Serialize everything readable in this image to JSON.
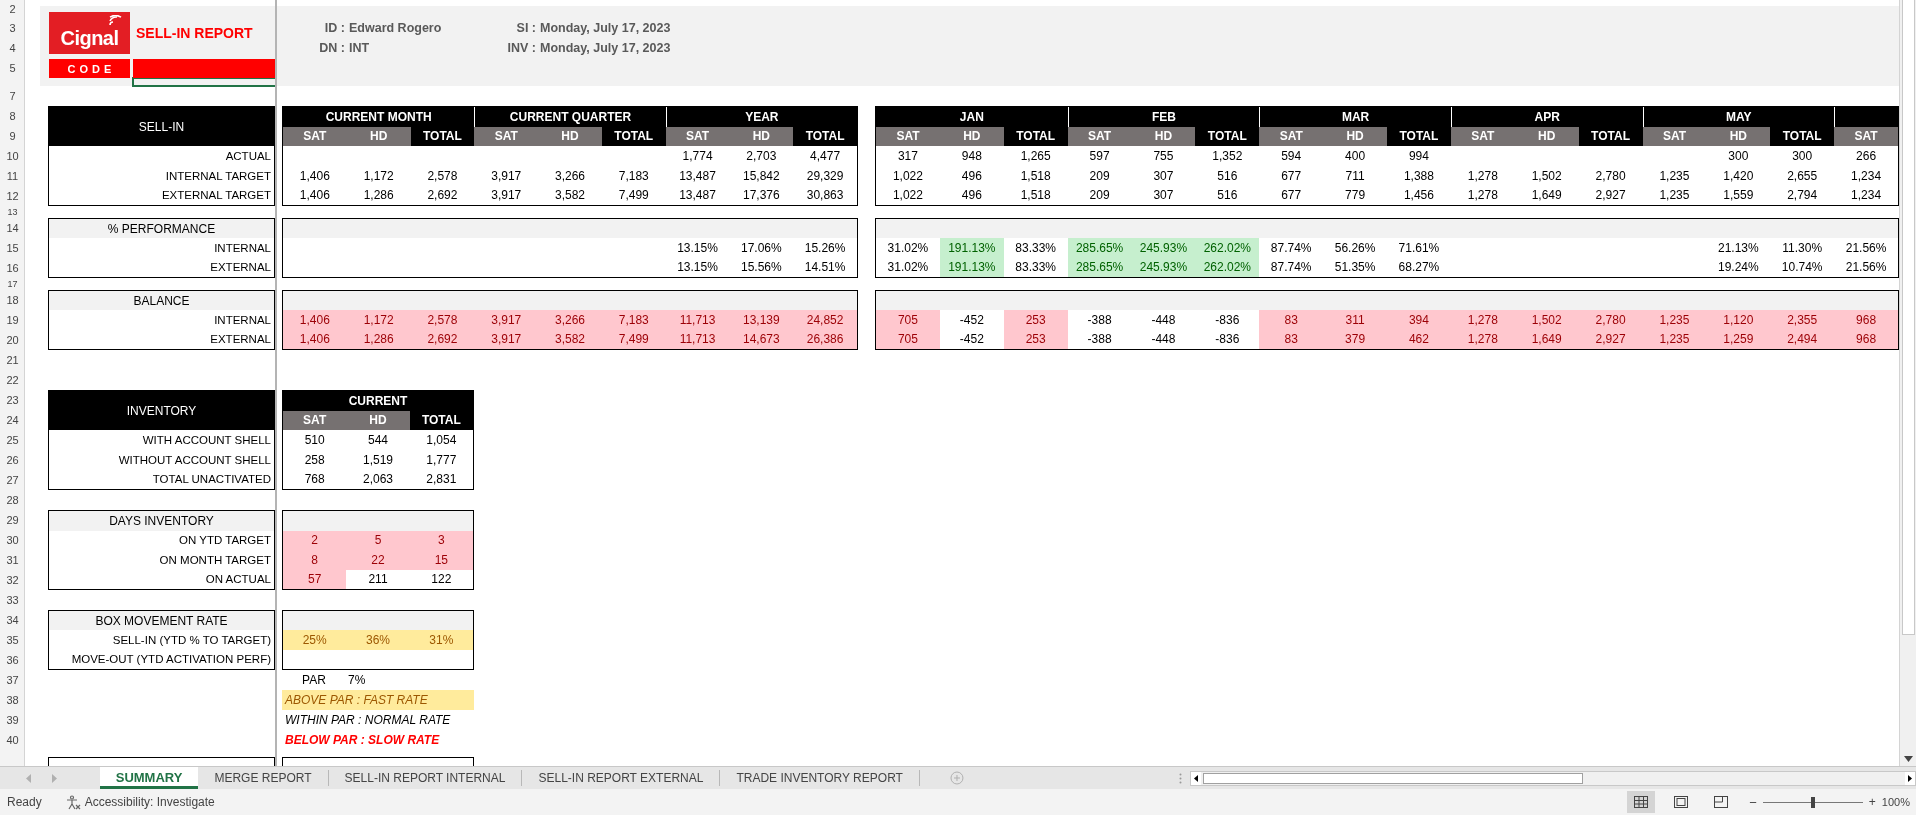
{
  "header": {
    "logo": "Cignal",
    "title": "SELL-IN REPORT",
    "code_label": "CODE",
    "fields": [
      {
        "label": "ID :",
        "value": "Edward Rogero"
      },
      {
        "label": "SI :",
        "value": "Monday, July 17, 2023"
      },
      {
        "label": "DN :",
        "value": "INT"
      },
      {
        "label": "INV :",
        "value": "Monday, July 17, 2023"
      }
    ]
  },
  "row_numbers": [
    "2",
    "3",
    "4",
    "5",
    "7",
    "8",
    "9",
    "10",
    "11",
    "12",
    "13",
    "14",
    "15",
    "16",
    "17",
    "18",
    "19",
    "20",
    "21",
    "22",
    "23",
    "24",
    "25",
    "26",
    "27",
    "28",
    "29",
    "30",
    "31",
    "32",
    "33",
    "34",
    "35",
    "36",
    "37",
    "38",
    "39",
    "40"
  ],
  "sections": [
    {
      "kind": "black",
      "title": "SELL-IN",
      "labels": [
        "ACTUAL",
        "INTERNAL TARGET",
        "EXTERNAL TARGET"
      ],
      "panels": [
        {
          "groups": [
            {
              "label": "CURRENT MONTH",
              "columns": [
                {
                  "label": "SAT",
                  "kind": "part"
                },
                {
                  "label": "HD",
                  "kind": "part"
                },
                {
                  "label": "TOTAL",
                  "kind": "total"
                }
              ]
            },
            {
              "label": "CURRENT QUARTER",
              "columns": [
                {
                  "label": "SAT",
                  "kind": "part"
                },
                {
                  "label": "HD",
                  "kind": "part"
                },
                {
                  "label": "TOTAL",
                  "kind": "total"
                }
              ]
            },
            {
              "label": "YEAR",
              "columns": [
                {
                  "label": "SAT",
                  "kind": "part"
                },
                {
                  "label": "HD",
                  "kind": "part"
                },
                {
                  "label": "TOTAL",
                  "kind": "total"
                }
              ]
            }
          ],
          "rows": [
            {
              "cells": [
                {
                  "kind": "empty"
                },
                {
                  "kind": "empty"
                },
                {
                  "kind": "empty"
                },
                {
                  "kind": "empty"
                },
                {
                  "kind": "empty"
                },
                {
                  "kind": "empty"
                },
                {
                  "kind": "value",
                  "text": "1,774"
                },
                {
                  "kind": "value",
                  "text": "2,703"
                },
                {
                  "kind": "value",
                  "text": "4,477"
                }
              ]
            },
            {
              "cells": [
                {
                  "kind": "value",
                  "text": "1,406"
                },
                {
                  "kind": "value",
                  "text": "1,172"
                },
                {
                  "kind": "value",
                  "text": "2,578"
                },
                {
                  "kind": "value",
                  "text": "3,917"
                },
                {
                  "kind": "value",
                  "text": "3,266"
                },
                {
                  "kind": "value",
                  "text": "7,183"
                },
                {
                  "kind": "value",
                  "text": "13,487"
                },
                {
                  "kind": "value",
                  "text": "15,842"
                },
                {
                  "kind": "value",
                  "text": "29,329"
                }
              ]
            },
            {
              "cells": [
                {
                  "kind": "value",
                  "text": "1,406"
                },
                {
                  "kind": "value",
                  "text": "1,286"
                },
                {
                  "kind": "value",
                  "text": "2,692"
                },
                {
                  "kind": "value",
                  "text": "3,917"
                },
                {
                  "kind": "value",
                  "text": "3,582"
                },
                {
                  "kind": "value",
                  "text": "7,499"
                },
                {
                  "kind": "value",
                  "text": "13,487"
                },
                {
                  "kind": "value",
                  "text": "17,376"
                },
                {
                  "kind": "value",
                  "text": "30,863"
                }
              ]
            }
          ]
        },
        {
          "groups": [
            {
              "label": "JAN",
              "columns": [
                {
                  "label": "SAT",
                  "kind": "part"
                },
                {
                  "label": "HD",
                  "kind": "part"
                },
                {
                  "label": "TOTAL",
                  "kind": "total"
                }
              ]
            },
            {
              "label": "FEB",
              "columns": [
                {
                  "label": "SAT",
                  "kind": "part"
                },
                {
                  "label": "HD",
                  "kind": "part"
                },
                {
                  "label": "TOTAL",
                  "kind": "total"
                }
              ]
            },
            {
              "label": "MAR",
              "columns": [
                {
                  "label": "SAT",
                  "kind": "part"
                },
                {
                  "label": "HD",
                  "kind": "part"
                },
                {
                  "label": "TOTAL",
                  "kind": "total"
                }
              ]
            },
            {
              "label": "APR",
              "columns": [
                {
                  "label": "SAT",
                  "kind": "part"
                },
                {
                  "label": "HD",
                  "kind": "part"
                },
                {
                  "label": "TOTAL",
                  "kind": "total"
                }
              ]
            },
            {
              "label": "MAY",
              "columns": [
                {
                  "label": "SAT",
                  "kind": "part"
                },
                {
                  "label": "HD",
                  "kind": "part"
                },
                {
                  "label": "TOTAL",
                  "kind": "total"
                }
              ]
            },
            {
              "columns": [
                {
                  "label": "SAT",
                  "kind": "part"
                }
              ]
            }
          ],
          "rows": [
            {
              "cells": [
                {
                  "kind": "value",
                  "text": "317"
                },
                {
                  "kind": "value",
                  "text": "948"
                },
                {
                  "kind": "value",
                  "text": "1,265"
                },
                {
                  "kind": "value",
                  "text": "597"
                },
                {
                  "kind": "value",
                  "text": "755"
                },
                {
                  "kind": "value",
                  "text": "1,352"
                },
                {
                  "kind": "value",
                  "text": "594"
                },
                {
                  "kind": "value",
                  "text": "400"
                },
                {
                  "kind": "value",
                  "text": "994"
                },
                {
                  "kind": "empty"
                },
                {
                  "kind": "empty"
                },
                {
                  "kind": "empty"
                },
                {
                  "kind": "empty"
                },
                {
                  "kind": "value",
                  "text": "300"
                },
                {
                  "kind": "value",
                  "text": "300"
                },
                {
                  "kind": "value",
                  "text": "266"
                }
              ]
            },
            {
              "cells": [
                {
                  "kind": "value",
                  "text": "1,022"
                },
                {
                  "kind": "value",
                  "text": "496"
                },
                {
                  "kind": "value",
                  "text": "1,518"
                },
                {
                  "kind": "value",
                  "text": "209"
                },
                {
                  "kind": "value",
                  "text": "307"
                },
                {
                  "kind": "value",
                  "text": "516"
                },
                {
                  "kind": "value",
                  "text": "677"
                },
                {
                  "kind": "value",
                  "text": "711"
                },
                {
                  "kind": "value",
                  "text": "1,388"
                },
                {
                  "kind": "value",
                  "text": "1,278"
                },
                {
                  "kind": "value",
                  "text": "1,502"
                },
                {
                  "kind": "value",
                  "text": "2,780"
                },
                {
                  "kind": "value",
                  "text": "1,235"
                },
                {
                  "kind": "value",
                  "text": "1,420"
                },
                {
                  "kind": "value",
                  "text": "2,655"
                },
                {
                  "kind": "value",
                  "text": "1,234"
                }
              ]
            },
            {
              "cells": [
                {
                  "kind": "value",
                  "text": "1,022"
                },
                {
                  "kind": "value",
                  "text": "496"
                },
                {
                  "kind": "value",
                  "text": "1,518"
                },
                {
                  "kind": "value",
                  "text": "209"
                },
                {
                  "kind": "value",
                  "text": "307"
                },
                {
                  "kind": "value",
                  "text": "516"
                },
                {
                  "kind": "value",
                  "text": "677"
                },
                {
                  "kind": "value",
                  "text": "779"
                },
                {
                  "kind": "value",
                  "text": "1,456"
                },
                {
                  "kind": "value",
                  "text": "1,278"
                },
                {
                  "kind": "value",
                  "text": "1,649"
                },
                {
                  "kind": "value",
                  "text": "2,927"
                },
                {
                  "kind": "value",
                  "text": "1,235"
                },
                {
                  "kind": "value",
                  "text": "1,559"
                },
                {
                  "kind": "value",
                  "text": "2,794"
                },
                {
                  "kind": "value",
                  "text": "1,234"
                }
              ]
            }
          ]
        }
      ]
    },
    {
      "kind": "grey",
      "title": "% PERFORMANCE",
      "labels": [
        "INTERNAL",
        "EXTERNAL"
      ],
      "panels": [
        {
          "rows": [
            {
              "cells": [
                {
                  "kind": "empty"
                },
                {
                  "kind": "empty"
                },
                {
                  "kind": "empty"
                },
                {
                  "kind": "empty"
                },
                {
                  "kind": "empty"
                },
                {
                  "kind": "empty"
                },
                {
                  "kind": "value",
                  "text": "13.15%"
                },
                {
                  "kind": "value",
                  "text": "17.06%"
                },
                {
                  "kind": "value",
                  "text": "15.26%"
                }
              ]
            },
            {
              "cells": [
                {
                  "kind": "empty"
                },
                {
                  "kind": "empty"
                },
                {
                  "kind": "empty"
                },
                {
                  "kind": "empty"
                },
                {
                  "kind": "empty"
                },
                {
                  "kind": "empty"
                },
                {
                  "kind": "value",
                  "text": "13.15%"
                },
                {
                  "kind": "value",
                  "text": "15.56%"
                },
                {
                  "kind": "value",
                  "text": "14.51%"
                }
              ]
            }
          ]
        },
        {
          "rows": [
            {
              "cells": [
                {
                  "kind": "value",
                  "text": "31.02%"
                },
                {
                  "kind": "value",
                  "text": "191.13%",
                  "color": "#c6efce"
                },
                {
                  "kind": "value",
                  "text": "83.33%"
                },
                {
                  "kind": "value",
                  "text": "285.65%",
                  "color": "#c6efce"
                },
                {
                  "kind": "value",
                  "text": "245.93%",
                  "color": "#c6efce"
                },
                {
                  "kind": "value",
                  "text": "262.02%",
                  "color": "#c6efce"
                },
                {
                  "kind": "value",
                  "text": "87.74%"
                },
                {
                  "kind": "value",
                  "text": "56.26%"
                },
                {
                  "kind": "value",
                  "text": "71.61%"
                },
                {
                  "kind": "empty"
                },
                {
                  "kind": "empty"
                },
                {
                  "kind": "empty"
                },
                {
                  "kind": "empty"
                },
                {
                  "kind": "value",
                  "text": "21.13%"
                },
                {
                  "kind": "value",
                  "text": "11.30%"
                },
                {
                  "kind": "value",
                  "text": "21.56%"
                }
              ]
            },
            {
              "cells": [
                {
                  "kind": "value",
                  "text": "31.02%"
                },
                {
                  "kind": "value",
                  "text": "191.13%",
                  "color": "#c6efce"
                },
                {
                  "kind": "value",
                  "text": "83.33%"
                },
                {
                  "kind": "value",
                  "text": "285.65%",
                  "color": "#c6efce"
                },
                {
                  "kind": "value",
                  "text": "245.93%",
                  "color": "#c6efce"
                },
                {
                  "kind": "value",
                  "text": "262.02%",
                  "color": "#c6efce"
                },
                {
                  "kind": "value",
                  "text": "87.74%"
                },
                {
                  "kind": "value",
                  "text": "51.35%"
                },
                {
                  "kind": "value",
                  "text": "68.27%"
                },
                {
                  "kind": "empty"
                },
                {
                  "kind": "empty"
                },
                {
                  "kind": "empty"
                },
                {
                  "kind": "empty"
                },
                {
                  "kind": "value",
                  "text": "19.24%"
                },
                {
                  "kind": "value",
                  "text": "10.74%"
                },
                {
                  "kind": "value",
                  "text": "21.56%"
                }
              ]
            }
          ]
        }
      ]
    },
    {
      "kind": "grey",
      "title": "BALANCE",
      "labels": [
        "INTERNAL",
        "EXTERNAL"
      ],
      "panels": [
        {
          "rows": [
            {
              "cells": [
                {
                  "kind": "value",
                  "text": "1,406",
                  "color": "#ffc7ce"
                },
                {
                  "kind": "value",
                  "text": "1,172",
                  "color": "#ffc7ce"
                },
                {
                  "kind": "value",
                  "text": "2,578",
                  "color": "#ffc7ce"
                },
                {
                  "kind": "value",
                  "text": "3,917",
                  "color": "#ffc7ce"
                },
                {
                  "kind": "value",
                  "text": "3,266",
                  "color": "#ffc7ce"
                },
                {
                  "kind": "value",
                  "text": "7,183",
                  "color": "#ffc7ce"
                },
                {
                  "kind": "value",
                  "text": "11,713",
                  "color": "#ffc7ce"
                },
                {
                  "kind": "value",
                  "text": "13,139",
                  "color": "#ffc7ce"
                },
                {
                  "kind": "value",
                  "text": "24,852",
                  "color": "#ffc7ce"
                }
              ]
            },
            {
              "cells": [
                {
                  "kind": "value",
                  "text": "1,406",
                  "color": "#ffc7ce"
                },
                {
                  "kind": "value",
                  "text": "1,286",
                  "color": "#ffc7ce"
                },
                {
                  "kind": "value",
                  "text": "2,692",
                  "color": "#ffc7ce"
                },
                {
                  "kind": "value",
                  "text": "3,917",
                  "color": "#ffc7ce"
                },
                {
                  "kind": "value",
                  "text": "3,582",
                  "color": "#ffc7ce"
                },
                {
                  "kind": "value",
                  "text": "7,499",
                  "color": "#ffc7ce"
                },
                {
                  "kind": "value",
                  "text": "11,713",
                  "color": "#ffc7ce"
                },
                {
                  "kind": "value",
                  "text": "14,673",
                  "color": "#ffc7ce"
                },
                {
                  "kind": "value",
                  "text": "26,386",
                  "color": "#ffc7ce"
                }
              ]
            }
          ]
        },
        {
          "rows": [
            {
              "cells": [
                {
                  "kind": "value",
                  "text": "705",
                  "color": "#ffc7ce"
                },
                {
                  "kind": "value",
                  "text": "-452"
                },
                {
                  "kind": "value",
                  "text": "253",
                  "color": "#ffc7ce"
                },
                {
                  "kind": "value",
                  "text": "-388"
                },
                {
                  "kind": "value",
                  "text": "-448"
                },
                {
                  "kind": "value",
                  "text": "-836"
                },
                {
                  "kind": "value",
                  "text": "83",
                  "color": "#ffc7ce"
                },
                {
                  "kind": "value",
                  "text": "311",
                  "color": "#ffc7ce"
                },
                {
                  "kind": "value",
                  "text": "394",
                  "color": "#ffc7ce"
                },
                {
                  "kind": "value",
                  "text": "1,278",
                  "color": "#ffc7ce"
                },
                {
                  "kind": "value",
                  "text": "1,502",
                  "color": "#ffc7ce"
                },
                {
                  "kind": "value",
                  "text": "2,780",
                  "color": "#ffc7ce"
                },
                {
                  "kind": "value",
                  "text": "1,235",
                  "color": "#ffc7ce"
                },
                {
                  "kind": "value",
                  "text": "1,120",
                  "color": "#ffc7ce"
                },
                {
                  "kind": "value",
                  "text": "2,355",
                  "color": "#ffc7ce"
                },
                {
                  "kind": "value",
                  "text": "968",
                  "color": "#ffc7ce"
                }
              ]
            },
            {
              "cells": [
                {
                  "kind": "value",
                  "text": "705",
                  "color": "#ffc7ce"
                },
                {
                  "kind": "value",
                  "text": "-452"
                },
                {
                  "kind": "value",
                  "text": "253",
                  "color": "#ffc7ce"
                },
                {
                  "kind": "value",
                  "text": "-388"
                },
                {
                  "kind": "value",
                  "text": "-448"
                },
                {
                  "kind": "value",
                  "text": "-836"
                },
                {
                  "kind": "value",
                  "text": "83",
                  "color": "#ffc7ce"
                },
                {
                  "kind": "value",
                  "text": "379",
                  "color": "#ffc7ce"
                },
                {
                  "kind": "value",
                  "text": "462",
                  "color": "#ffc7ce"
                },
                {
                  "kind": "value",
                  "text": "1,278",
                  "color": "#ffc7ce"
                },
                {
                  "kind": "value",
                  "text": "1,649",
                  "color": "#ffc7ce"
                },
                {
                  "kind": "value",
                  "text": "2,927",
                  "color": "#ffc7ce"
                },
                {
                  "kind": "value",
                  "text": "1,235",
                  "color": "#ffc7ce"
                },
                {
                  "kind": "value",
                  "text": "1,259",
                  "color": "#ffc7ce"
                },
                {
                  "kind": "value",
                  "text": "2,494",
                  "color": "#ffc7ce"
                },
                {
                  "kind": "value",
                  "text": "968",
                  "color": "#ffc7ce"
                }
              ]
            }
          ]
        }
      ]
    },
    {
      "kind": "black",
      "title": "INVENTORY",
      "labels": [
        "WITH ACCOUNT SHELL",
        "WITHOUT ACCOUNT SHELL",
        "TOTAL UNACTIVATED"
      ],
      "panels": [
        {
          "groups": [
            {
              "label": "CURRENT",
              "columns": [
                {
                  "label": "SAT",
                  "kind": "part"
                },
                {
                  "label": "HD",
                  "kind": "part"
                },
                {
                  "label": "TOTAL",
                  "kind": "total"
                }
              ]
            }
          ],
          "rows": [
            {
              "cells": [
                {
                  "kind": "value",
                  "text": "510"
                },
                {
                  "kind": "value",
                  "text": "544"
                },
                {
                  "kind": "value",
                  "text": "1,054"
                }
              ]
            },
            {
              "cells": [
                {
                  "kind": "value",
                  "text": "258"
                },
                {
                  "kind": "value",
                  "text": "1,519"
                },
                {
                  "kind": "value",
                  "text": "1,777"
                }
              ]
            },
            {
              "cells": [
                {
                  "kind": "value",
                  "text": "768"
                },
                {
                  "kind": "value",
                  "text": "2,063"
                },
                {
                  "kind": "value",
                  "text": "2,831"
                }
              ]
            }
          ]
        }
      ]
    },
    {
      "kind": "grey",
      "title": "DAYS INVENTORY",
      "labels": [
        "ON YTD TARGET",
        "ON MONTH TARGET",
        "ON ACTUAL"
      ],
      "panels": [
        {
          "rows": [
            {
              "cells": [
                {
                  "kind": "value",
                  "text": "2",
                  "color": "#ffc7ce"
                },
                {
                  "kind": "value",
                  "text": "5",
                  "color": "#ffc7ce"
                },
                {
                  "kind": "value",
                  "text": "3",
                  "color": "#ffc7ce"
                }
              ]
            },
            {
              "cells": [
                {
                  "kind": "value",
                  "text": "8",
                  "color": "#ffc7ce"
                },
                {
                  "kind": "value",
                  "text": "22",
                  "color": "#ffc7ce"
                },
                {
                  "kind": "value",
                  "text": "15",
                  "color": "#ffc7ce"
                }
              ]
            },
            {
              "cells": [
                {
                  "kind": "value",
                  "text": "57",
                  "color": "#ffc7ce"
                },
                {
                  "kind": "value",
                  "text": "211"
                },
                {
                  "kind": "value",
                  "text": "122"
                }
              ]
            }
          ]
        }
      ]
    },
    {
      "kind": "grey",
      "title": "BOX MOVEMENT RATE",
      "labels": [
        "SELL-IN (YTD % TO TARGET)",
        "MOVE-OUT (YTD ACTIVATION PERF)"
      ],
      "panels": [
        {
          "rows": [
            {
              "cells": [
                {
                  "kind": "value",
                  "text": "25%",
                  "color": "#ffeb9c"
                },
                {
                  "kind": "value",
                  "text": "36%",
                  "color": "#ffeb9c"
                },
                {
                  "kind": "value",
                  "text": "31%",
                  "color": "#ffeb9c"
                }
              ]
            },
            {
              "cells": [
                {
                  "kind": "empty"
                },
                {
                  "kind": "empty"
                },
                {
                  "kind": "empty"
                }
              ]
            }
          ]
        }
      ]
    }
  ],
  "par": {
    "label": "PAR",
    "value": "7%"
  },
  "legend": [
    {
      "kind": "above",
      "text": "ABOVE PAR : FAST RATE"
    },
    {
      "kind": "within",
      "text": "WITHIN PAR : NORMAL RATE"
    },
    {
      "kind": "below",
      "text": "BELOW PAR : SLOW RATE"
    }
  ],
  "tabs": [
    {
      "label": "SUMMARY",
      "selected": true
    },
    {
      "label": "MERGE REPORT",
      "selected": false
    },
    {
      "label": "SELL-IN REPORT INTERNAL",
      "selected": false
    },
    {
      "label": "SELL-IN REPORT EXTERNAL",
      "selected": false
    },
    {
      "label": "TRADE INVENTORY REPORT",
      "selected": false
    }
  ],
  "status_bar": {
    "status": "Ready",
    "accessibility": "Accessibility: Investigate",
    "views": [
      {
        "kind": "normal",
        "selected": true
      },
      {
        "kind": "layout",
        "selected": false
      },
      {
        "kind": "break",
        "selected": false
      }
    ],
    "zoom": {
      "minus": "−",
      "plus": "+",
      "level": 0.5,
      "value": "100%"
    }
  }
}
